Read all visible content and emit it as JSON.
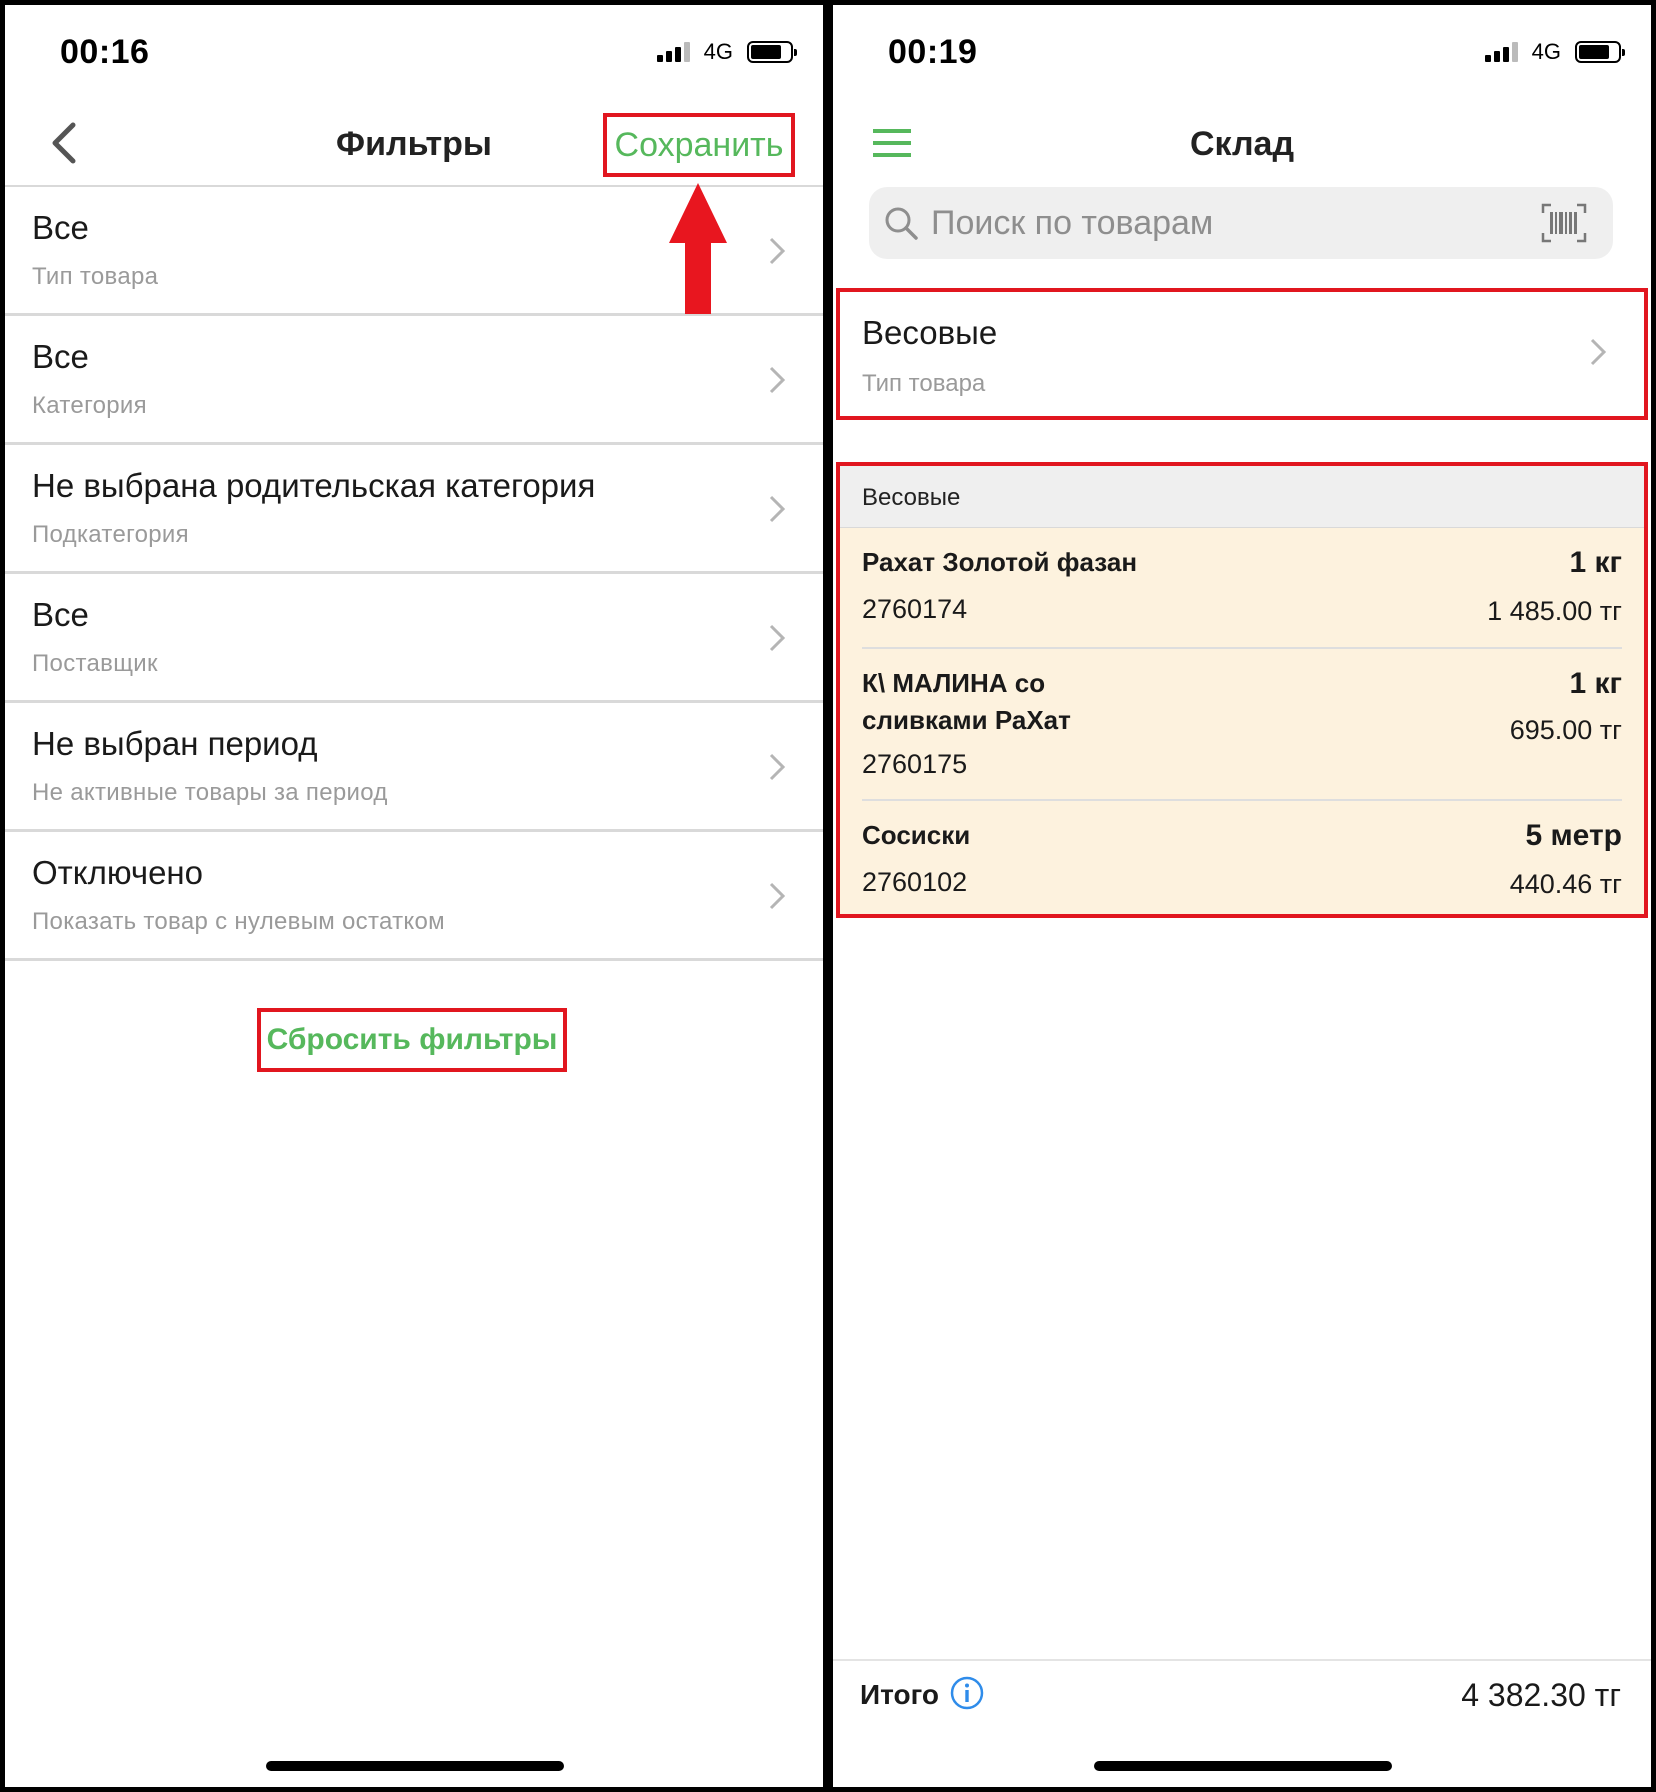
{
  "left": {
    "status": {
      "time": "00:16",
      "network": "4G"
    },
    "nav": {
      "title": "Фильтры",
      "save_label": "Сохранить"
    },
    "filters": [
      {
        "value": "Все",
        "label": "Тип товара"
      },
      {
        "value": "Все",
        "label": "Категория"
      },
      {
        "value": "Не выбрана родительская категория",
        "label": "Подкатегория"
      },
      {
        "value": "Все",
        "label": "Поставщик"
      },
      {
        "value": "Не выбран период",
        "label": "Не активные товары за период"
      },
      {
        "value": "Отключено",
        "label": "Показать товар с нулевым остатком"
      }
    ],
    "reset_label": "Сбросить фильтры"
  },
  "right": {
    "status": {
      "time": "00:19",
      "network": "4G"
    },
    "nav": {
      "title": "Склад"
    },
    "search": {
      "placeholder": "Поиск по товарам"
    },
    "type_filter": {
      "value": "Весовые",
      "label": "Тип товара"
    },
    "group": {
      "name": "Весовые",
      "items": [
        {
          "name": "Рахат Золотой фазан",
          "code": "2760174",
          "qty": "1 кг",
          "price": "1 485.00 тг"
        },
        {
          "name_lines": [
            "К\\ МАЛИНА со",
            "сливками РаХат"
          ],
          "code": "2760175",
          "qty": "1 кг",
          "price": "695.00 тг"
        },
        {
          "name": "Сосиски",
          "code": "2760102",
          "qty": "5 метр",
          "price": "440.46 тг"
        }
      ]
    },
    "footer": {
      "total_label": "Итого",
      "total_value": "4 382.30 тг"
    }
  },
  "colors": {
    "accent_green": "#56b85c",
    "highlight_red": "#e1161f",
    "item_bg": "#fdf2de"
  },
  "icons": [
    "back-chevron-icon",
    "chevron-right-icon",
    "menu-icon",
    "search-icon",
    "barcode-icon",
    "info-icon",
    "signal-icon",
    "battery-icon",
    "up-arrow-annotation"
  ]
}
